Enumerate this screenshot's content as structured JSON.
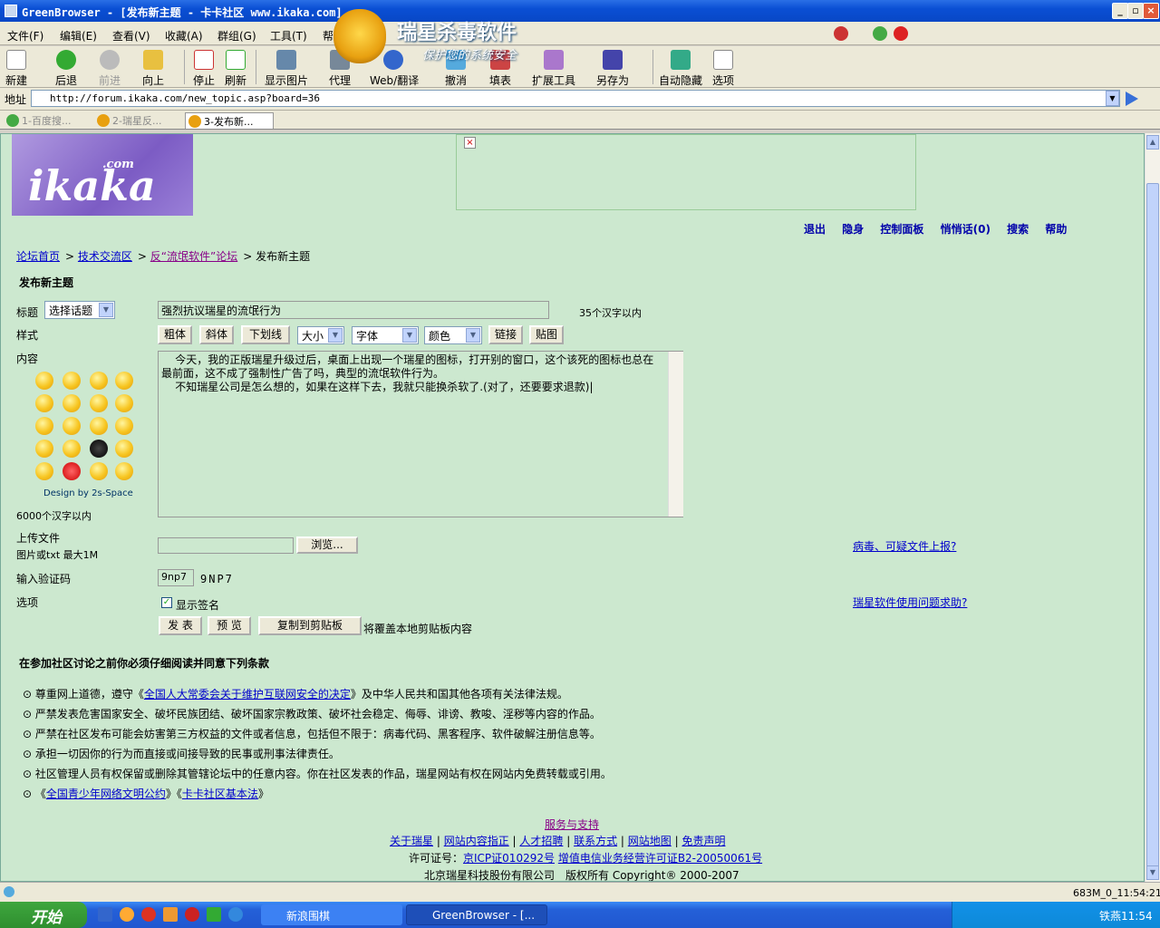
{
  "window": {
    "title": "GreenBrowser - [发布新主题 - 卡卡社区 www.ikaka.com]",
    "controls": [
      "_",
      "▫",
      "×"
    ]
  },
  "menu": [
    "文件(F)",
    "编辑(E)",
    "查看(V)",
    "收藏(A)",
    "群组(G)",
    "工具(T)",
    "帮"
  ],
  "banner": {
    "title": "瑞星杀毒软件",
    "subtitle": "保护您的系统安全"
  },
  "toolbar": [
    "新建",
    "后退",
    "前进",
    "向上",
    "停止",
    "刷新",
    "显示图片",
    "代理",
    "Web/翻译",
    "撤消",
    "填表",
    "扩展工具",
    "另存为",
    "自动隐藏",
    "选项"
  ],
  "address": {
    "label": "地址",
    "url": "http://forum.ikaka.com/new_topic.asp?board=36"
  },
  "tabs": [
    "1-百度搜...",
    "2-瑞星反...",
    "3-发布新..."
  ],
  "site": {
    "logo": "ikaka",
    "logo_com": ".com",
    "topnav": [
      "退出",
      "隐身",
      "控制面板",
      "悄悄话(0)",
      "搜索",
      "帮助"
    ],
    "breadcrumb": [
      "论坛首页",
      "技术交流区",
      "反“流氓软件”论坛",
      "发布新主题"
    ],
    "heading": "发布新主题"
  },
  "form": {
    "title_label": "标题",
    "topic_select": "选择话题",
    "title_value": "强烈抗议瑞星的流氓行为",
    "title_hint": "35个汉字以内",
    "style_label": "样式",
    "style_buttons": [
      "粗体",
      "斜体",
      "下划线"
    ],
    "size_select": "大小",
    "font_select": "字体",
    "color_select": "颜色",
    "link_button": "链接",
    "image_button": "贴图",
    "content_label": "内容",
    "content_text": "    今天，我的正版瑞星升级过后，桌面上出现一个瑞星的图标，打开别的窗口，这个该死的图标也总在最前面，这不成了强制性广告了吗，典型的流氓软件行为。\n    不知瑞星公司是怎么想的，如果在这样下去，我就只能换杀软了.(对了，还要要求退款)|",
    "emoticon_credit": "Design by 2s-Space",
    "content_hint": "6000个汉字以内",
    "upload_label": "上传文件",
    "upload_hint": "图片或txt 最大1M",
    "browse_button": "浏览...",
    "virus_link": "病毒、可疑文件上报?",
    "captcha_label": "输入验证码",
    "captcha_value": "9np7",
    "captcha_image": "9NP7",
    "options_label": "选项",
    "show_signature": "显示签名",
    "help_link": "瑞星软件使用问题求助?",
    "submit_button": "发 表",
    "preview_button": "预 览",
    "copy_button": "复制到剪贴板",
    "copy_hint": "将覆盖本地剪贴板内容"
  },
  "terms": {
    "heading": "在参加社区讨论之前你必须仔细阅读并同意下列条款",
    "items": [
      {
        "pre": "尊重网上道德，遵守《",
        "link": "全国人大常委会关于维护互联网安全的决定",
        "post": "》及中华人民共和国其他各项有关法律法规。"
      },
      {
        "pre": "严禁发表危害国家安全、破坏民族团结、破坏国家宗教政策、破坏社会稳定、侮辱、诽谤、教唆、淫秽等内容的作品。",
        "link": "",
        "post": ""
      },
      {
        "pre": "严禁在社区发布可能会妨害第三方权益的文件或者信息，包括但不限于：病毒代码、黑客程序、软件破解注册信息等。",
        "link": "",
        "post": ""
      },
      {
        "pre": "承担一切因你的行为而直接或间接导致的民事或刑事法律责任。",
        "link": "",
        "post": ""
      },
      {
        "pre": "社区管理人员有权保留或删除其管辖论坛中的任意内容。你在社区发表的作品，瑞星网站有权在网站内免费转载或引用。",
        "link": "",
        "post": ""
      }
    ],
    "last": {
      "a": "全国青少年网络文明公约",
      "b": "卡卡社区基本法"
    }
  },
  "footer": {
    "service": "服务与支持",
    "links": [
      "关于瑞星",
      "网站内容指正",
      "人才招聘",
      "联系方式",
      "网站地图",
      "免责声明"
    ],
    "license_label": "许可证号：",
    "icp": "京ICP证010292号",
    "icp2": "增值电信业务经营许可证B2-20050061号",
    "company": "北京瑞星科技股份有限公司　版权所有 Copyright",
    "years": " 2000-2007"
  },
  "status": {
    "right": "683M_0_11:54:21"
  },
  "taskbar": {
    "start": "开始",
    "tasks": [
      "新浪围棋",
      "GreenBrowser - [..."
    ],
    "clock": "铁燕11:54"
  }
}
